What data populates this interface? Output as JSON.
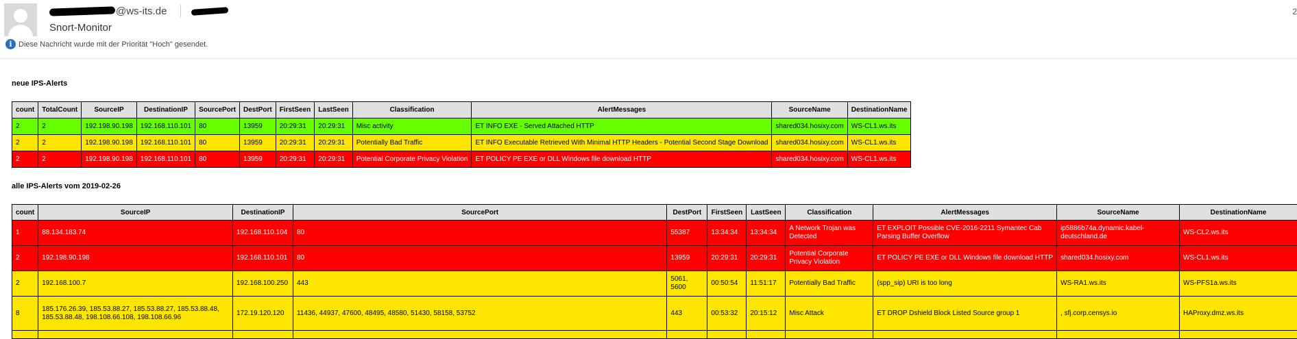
{
  "header": {
    "sender_domain": "@ws-its.de",
    "subject": "Snort-Monitor",
    "priority_note": "Diese Nachricht wurde mit der Priorität \"Hoch\" gesendet.",
    "date_partial": "2"
  },
  "colors": {
    "green": "#66ff00",
    "yellow": "#ffe600",
    "red": "#ff0000",
    "header": "#e0e0e0"
  },
  "table1": {
    "title": "neue IPS-Alerts",
    "headers": [
      "count",
      "TotalCount",
      "SourceIP",
      "DestinationIP",
      "SourcePort",
      "DestPort",
      "FirstSeen",
      "LastSeen",
      "Classification",
      "AlertMessages",
      "SourceName",
      "DestinationName"
    ],
    "rows": [
      {
        "level": "green",
        "cells": [
          "2",
          "2",
          "192.198.90.198",
          "192.168.110.101",
          "80",
          "13959",
          "20:29:31",
          "20:29:31",
          "Misc activity",
          "ET INFO EXE - Served Attached HTTP",
          "shared034.hosixy.com",
          "WS-CL1.ws.its"
        ]
      },
      {
        "level": "yellow",
        "cells": [
          "2",
          "2",
          "192.198.90.198",
          "192.168.110.101",
          "80",
          "13959",
          "20:29:31",
          "20:29:31",
          "Potentially Bad Traffic",
          "ET INFO Executable Retrieved With Minimal HTTP Headers - Potential Second Stage Download",
          "shared034.hosixy.com",
          "WS-CL1.ws.its"
        ]
      },
      {
        "level": "red",
        "cells": [
          "2",
          "2",
          "192.198.90.198",
          "192.168.110.101",
          "80",
          "13959",
          "20:29:31",
          "20:29:31",
          "Potential Corporate Privacy Violation",
          "ET POLICY PE EXE or DLL Windows file download HTTP",
          "shared034.hosixy.com",
          "WS-CL1.ws.its"
        ]
      }
    ]
  },
  "table2": {
    "title": "alle IPS-Alerts vom 2019-02-26",
    "headers": [
      "count",
      "SourceIP",
      "DestinationIP",
      "SourcePort",
      "DestPort",
      "FirstSeen",
      "LastSeen",
      "Classification",
      "AlertMessages",
      "SourceName",
      "DestinationName"
    ],
    "rows": [
      {
        "level": "red",
        "cells": [
          "1",
          "88.134.183.74",
          "192.168.110.104",
          "80",
          "55387",
          "13:34:34",
          "13:34:34",
          "A Network Trojan was Detected",
          "ET EXPLOIT Possible CVE-2016-2211 Symantec Cab Parsing Buffer Overflow",
          "ip5886b74a.dynamic.kabel-deutschland.de",
          "WS-CL2.ws.its"
        ]
      },
      {
        "level": "red",
        "cells": [
          "2",
          "192.198.90.198",
          "192.168.110.101",
          "80",
          "13959",
          "20:29:31",
          "20:29:31",
          "Potential Corporate Privacy Violation",
          "ET POLICY PE EXE or DLL Windows file download HTTP",
          "shared034.hosixy.com",
          "WS-CL1.ws.its"
        ]
      },
      {
        "level": "yellow",
        "cells": [
          "2",
          "192.168.100.7",
          "192.168.100.250",
          "443",
          "5061, 5600",
          "00:50:54",
          "11:51:17",
          "Potentially Bad Traffic",
          "(spp_sip) URI is too long",
          "WS-RA1.ws.its",
          "WS-PFS1a.ws.its"
        ]
      },
      {
        "level": "yellow",
        "cells": [
          "8",
          "185.176.26.39, 185.53.88.27, 185.53.88.27, 185.53.88.48, 185.53.88.48, 198.108.66.108, 198.108.66.96",
          "172.19.120.120",
          "11436, 44937, 47600, 48495, 48580, 51430, 58158, 53752",
          "443",
          "00:53:32",
          "20:15:12",
          "Misc Attack",
          "ET DROP Dshield Block Listed Source group 1",
          ", sfj.corp.censys.io",
          "HAProxy.dmz.ws.its"
        ]
      },
      {
        "level": "yellow",
        "cells": [
          "",
          "",
          "",
          "",
          "",
          "",
          "",
          "",
          "",
          "",
          ""
        ]
      }
    ]
  }
}
